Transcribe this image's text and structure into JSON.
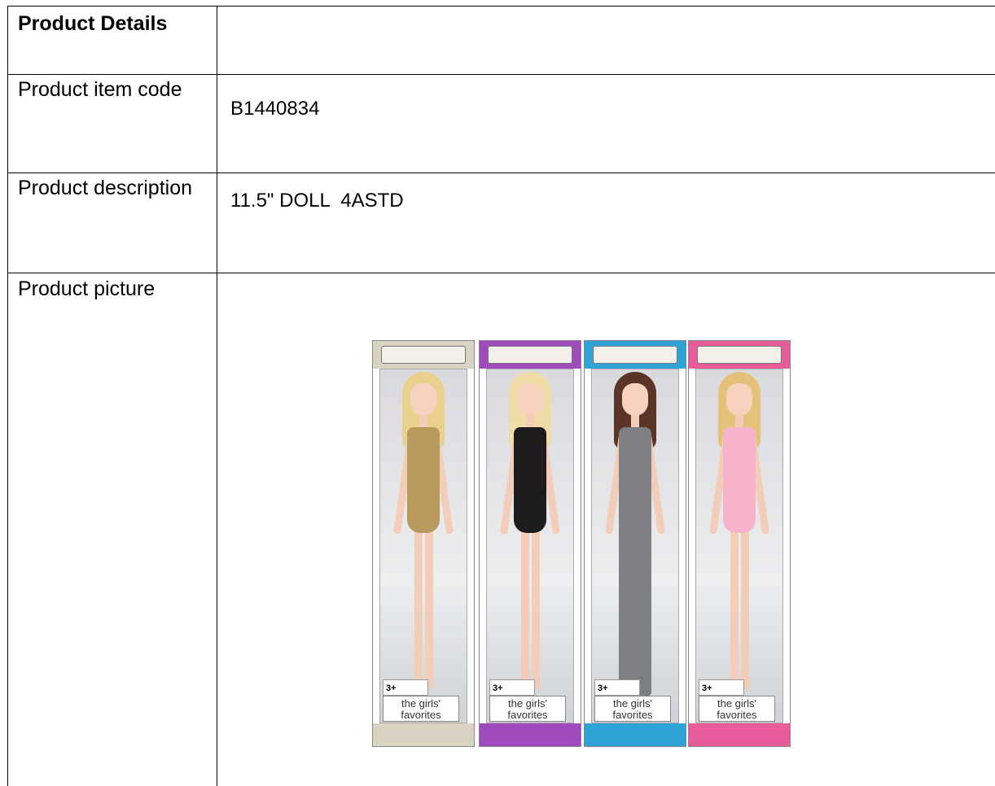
{
  "table": {
    "header": {
      "label": "Product Details",
      "value": ""
    },
    "rows": [
      {
        "label": "Product item code",
        "value": "B1440834"
      },
      {
        "label": "Product description",
        "value": "11.5\" DOLL  4ASTD"
      },
      {
        "label": "Product picture",
        "value": ""
      }
    ]
  },
  "picture": {
    "boxes": [
      {
        "age_label": "3+",
        "brand_label": "the girls' favorites",
        "band_color": "#d9d3c4",
        "hair_color": "#e9d08c",
        "dress_color": "#b89a5e",
        "legs_bare": true
      },
      {
        "age_label": "3+",
        "brand_label": "the girls' favorites",
        "band_color": "#a04bbd",
        "hair_color": "#efdca6",
        "dress_color": "#1c1c1c",
        "legs_bare": true
      },
      {
        "age_label": "3+",
        "brand_label": "the girls' favorites",
        "band_color": "#2fa3d6",
        "hair_color": "#5a3426",
        "dress_color": "#7d7f82",
        "legs_bare": false
      },
      {
        "age_label": "3+",
        "brand_label": "the girls' favorites",
        "band_color": "#e85c9c",
        "hair_color": "#e5c27a",
        "dress_color": "#f7b3cc",
        "legs_bare": true
      }
    ]
  }
}
